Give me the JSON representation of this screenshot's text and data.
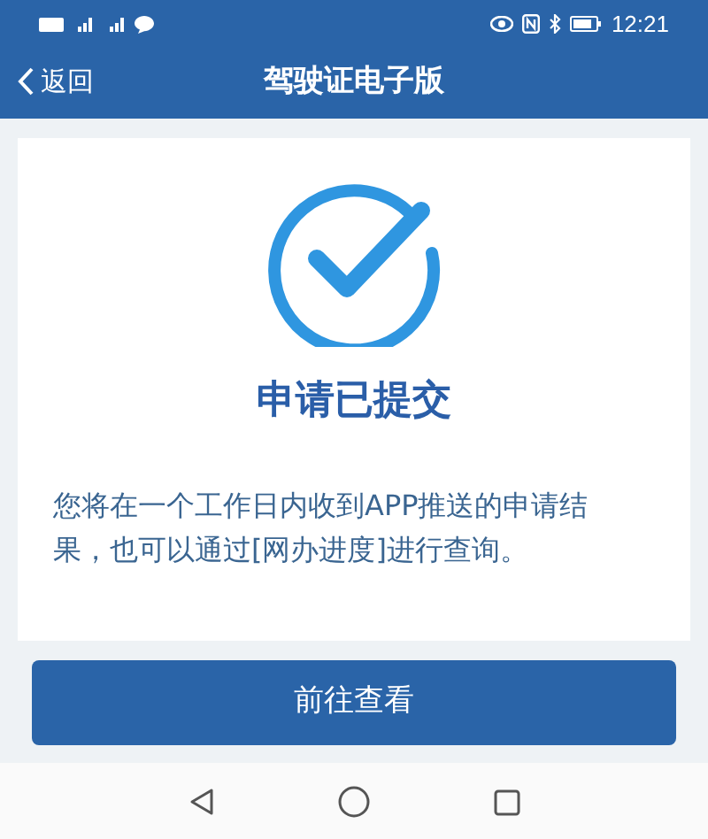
{
  "status_bar": {
    "time": "12:21"
  },
  "header": {
    "back": "返回",
    "title": "驾驶证电子版"
  },
  "result": {
    "title": "申请已提交",
    "message": "您将在一个工作日内收到APP推送的申请结果，也可以通过[网办进度]进行查询。"
  },
  "button": "前往查看"
}
